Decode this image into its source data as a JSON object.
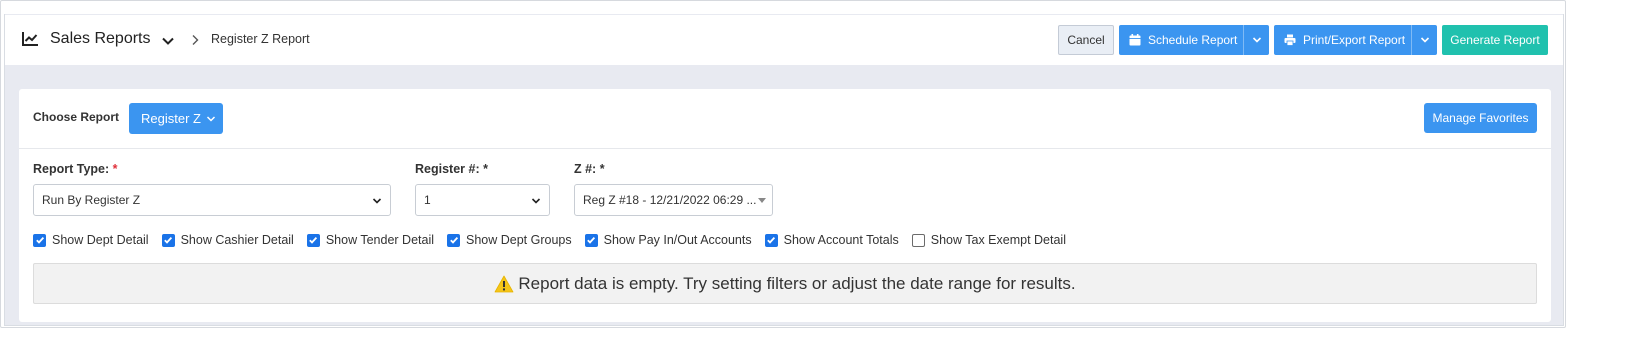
{
  "header": {
    "title": "Sales Reports",
    "breadcrumb": "Register Z Report",
    "cancel_label": "Cancel",
    "schedule_label": "Schedule Report",
    "print_label": "Print/Export Report",
    "generate_label": "Generate Report"
  },
  "card": {
    "choose_label": "Choose Report",
    "report_button_label": "Register Z",
    "favorites_label": "Manage Favorites"
  },
  "filters": {
    "report_type": {
      "label": "Report Type:",
      "required_mark": "*",
      "value": "Run By Register Z"
    },
    "register": {
      "label": "Register #:",
      "required_mark": "*",
      "value": "1"
    },
    "z_number": {
      "label": "Z #:",
      "required_mark": "*",
      "value": "Reg Z #18 - 12/21/2022 06:29 ..."
    }
  },
  "options": [
    {
      "label": "Show Dept Detail",
      "checked": true
    },
    {
      "label": "Show Cashier Detail",
      "checked": true
    },
    {
      "label": "Show Tender Detail",
      "checked": true
    },
    {
      "label": "Show Dept Groups",
      "checked": true
    },
    {
      "label": "Show Pay In/Out Accounts",
      "checked": true
    },
    {
      "label": "Show Account Totals",
      "checked": true
    },
    {
      "label": "Show Tax Exempt Detail",
      "checked": false
    }
  ],
  "message": "Report data is empty. Try setting filters or adjust the date range for results.",
  "colors": {
    "primary": "#3b95f0",
    "generate": "#20c1ae",
    "required": "#e0303a",
    "warning": "#f5c518",
    "checkbox": "#1a73e8"
  },
  "icons": [
    "chart-line-icon",
    "chevron-down-icon",
    "chevron-right-icon",
    "calendar-icon",
    "printer-icon",
    "warning-icon"
  ]
}
